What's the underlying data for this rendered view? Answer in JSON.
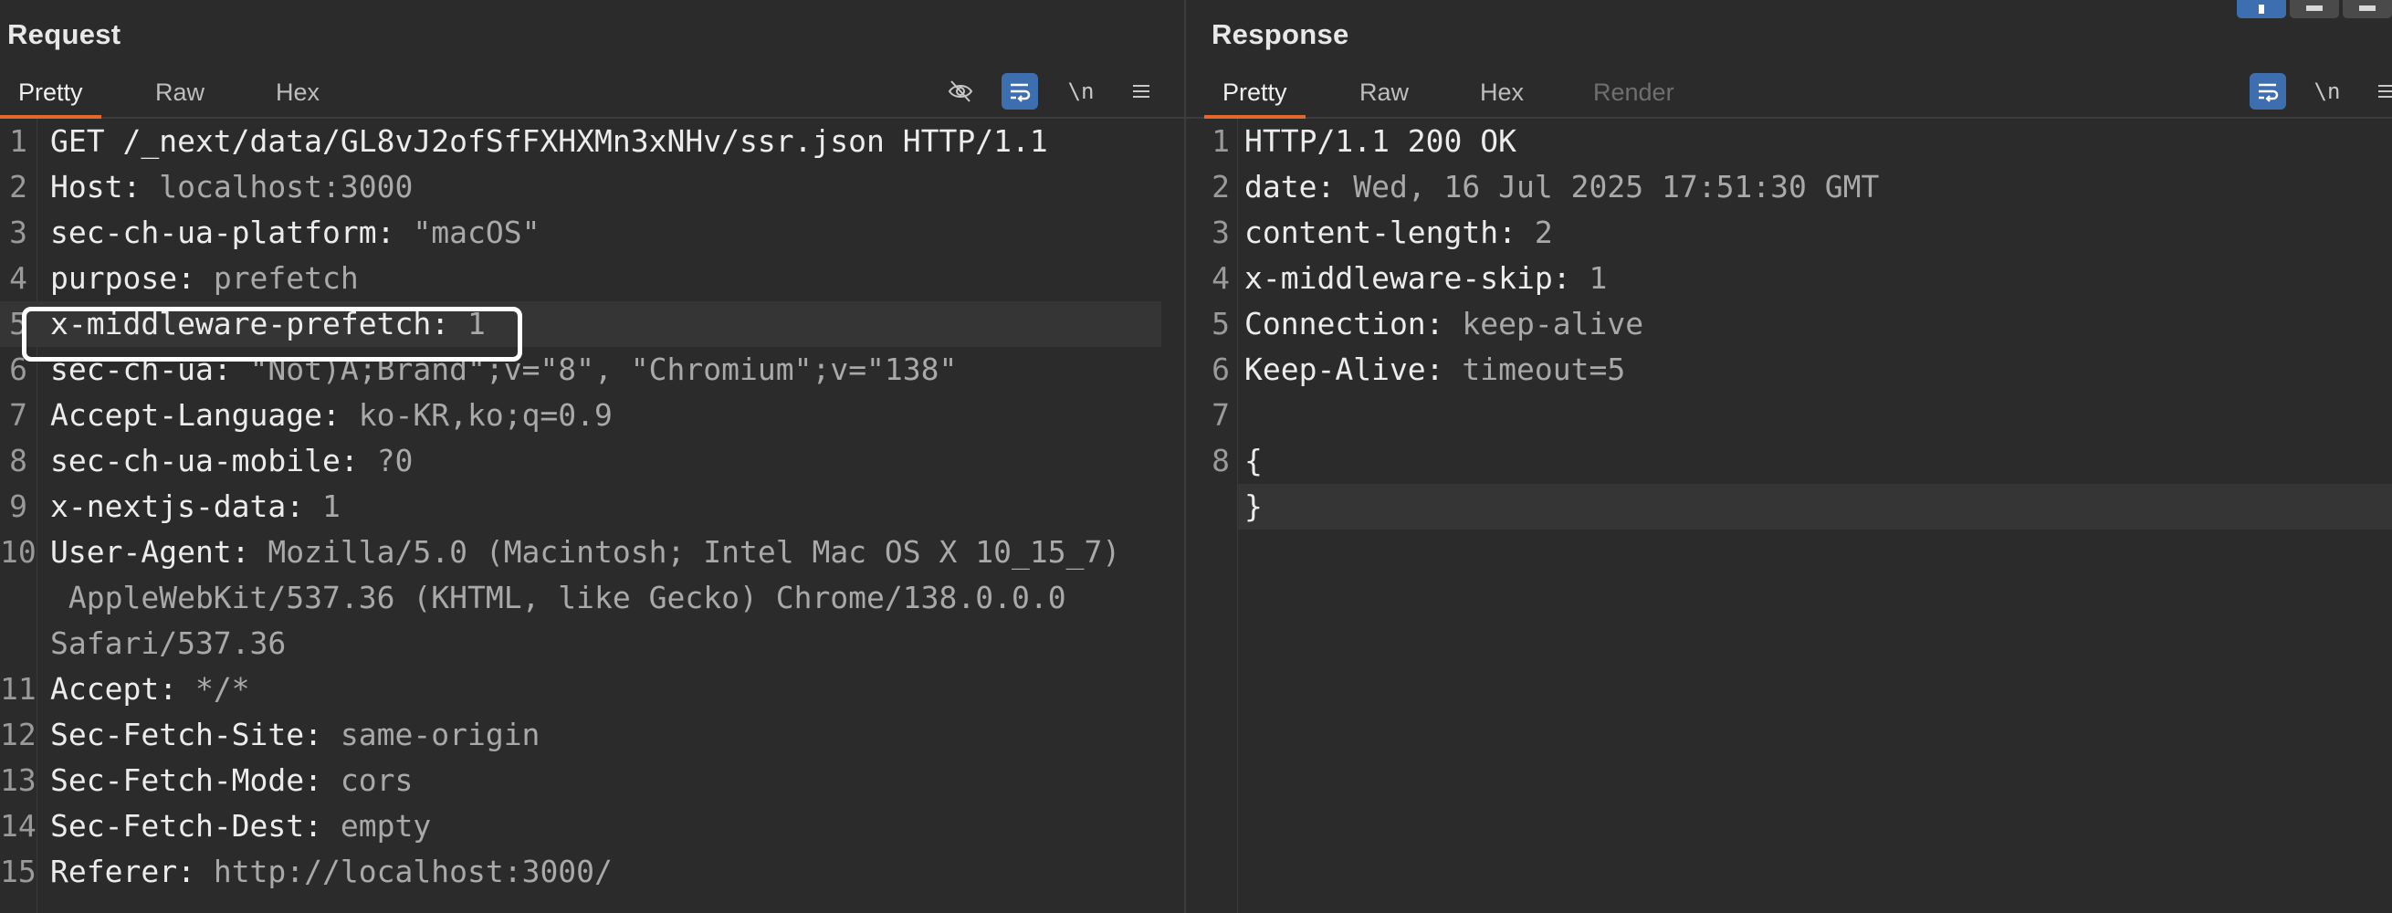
{
  "request": {
    "title": "Request",
    "tabs": [
      "Pretty",
      "Raw",
      "Hex"
    ],
    "toolbar": {
      "newline_label": "\\n"
    },
    "lines": [
      {
        "n": "1",
        "k": "GET /_next/data/GL8vJ2ofSfFXHXMn3xNHv/ssr.json HTTP/1.1",
        "v": ""
      },
      {
        "n": "2",
        "k": "Host:",
        "v": " localhost:3000"
      },
      {
        "n": "3",
        "k": "sec-ch-ua-platform:",
        "v": " \"macOS\""
      },
      {
        "n": "4",
        "k": "purpose:",
        "v": " prefetch"
      },
      {
        "n": "5",
        "k": "x-middleware-prefetch:",
        "v": " 1"
      },
      {
        "n": "6",
        "k": "sec-ch-ua:",
        "v": " \"Not)A;Brand\";v=\"8\", \"Chromium\";v=\"138\""
      },
      {
        "n": "7",
        "k": "Accept-Language:",
        "v": " ko-KR,ko;q=0.9"
      },
      {
        "n": "8",
        "k": "sec-ch-ua-mobile:",
        "v": " ?0"
      },
      {
        "n": "9",
        "k": "x-nextjs-data:",
        "v": " 1"
      },
      {
        "n": "10",
        "k": "User-Agent:",
        "v": " Mozilla/5.0 (Macintosh; Intel Mac OS X 10_15_7)"
      },
      {
        "n": "",
        "k": "",
        "v": " AppleWebKit/537.36 (KHTML, like Gecko) Chrome/138.0.0.0"
      },
      {
        "n": "",
        "k": "",
        "v": "Safari/537.36"
      },
      {
        "n": "11",
        "k": "Accept:",
        "v": " */*"
      },
      {
        "n": "12",
        "k": "Sec-Fetch-Site:",
        "v": " same-origin"
      },
      {
        "n": "13",
        "k": "Sec-Fetch-Mode:",
        "v": " cors"
      },
      {
        "n": "14",
        "k": "Sec-Fetch-Dest:",
        "v": " empty"
      },
      {
        "n": "15",
        "k": "Referer:",
        "v": " http://localhost:3000/"
      }
    ]
  },
  "response": {
    "title": "Response",
    "tabs": [
      "Pretty",
      "Raw",
      "Hex",
      "Render"
    ],
    "toolbar": {
      "newline_label": "\\n"
    },
    "lines": [
      {
        "n": "1",
        "k": "HTTP/1.1 200 OK",
        "v": ""
      },
      {
        "n": "2",
        "k": "date:",
        "v": " Wed, 16 Jul 2025 17:51:30 GMT"
      },
      {
        "n": "3",
        "k": "content-length:",
        "v": " 2"
      },
      {
        "n": "4",
        "k": "x-middleware-skip:",
        "v": " 1"
      },
      {
        "n": "5",
        "k": "Connection:",
        "v": " keep-alive"
      },
      {
        "n": "6",
        "k": "Keep-Alive:",
        "v": " timeout=5"
      },
      {
        "n": "7",
        "k": "",
        "v": ""
      },
      {
        "n": "8",
        "k": "{",
        "v": ""
      },
      {
        "n": "",
        "k": "}",
        "v": ""
      }
    ]
  },
  "colors": {
    "background": "#2b2b2b",
    "accent_tab": "#e3682b",
    "active_tool": "#3d6fb0",
    "header_key": "#ececec",
    "header_value": "#a9a9a9"
  }
}
